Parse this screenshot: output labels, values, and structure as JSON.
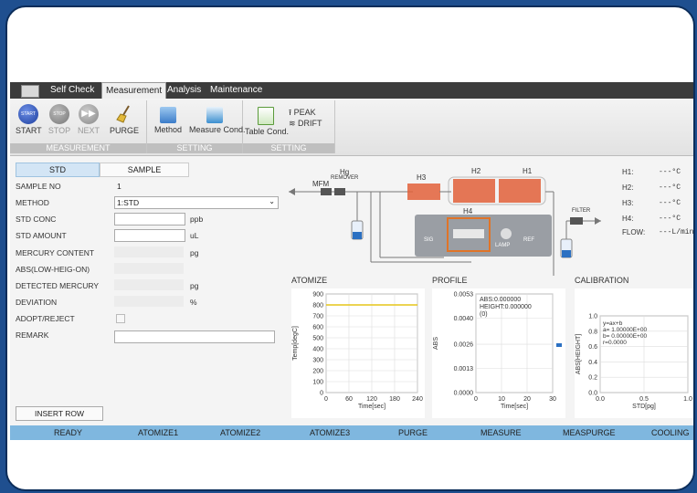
{
  "menubar": {
    "tabs": [
      "Self Check",
      "Measurement",
      "Analysis",
      "Maintenance"
    ]
  },
  "ribbon": {
    "groups": {
      "measurement": "MEASUREMENT",
      "setting1": "SETTING",
      "setting2": "SETTING"
    },
    "start": "START",
    "stop": "STOP",
    "next": "NEXT",
    "purge": "PURGE",
    "method": "Method",
    "measure_cond": "Measure Cond.",
    "table_cond": "Table Cond.",
    "peak": "PEAK",
    "drift": "DRIFT",
    "start_icon_text": "START",
    "stop_icon_text": "STOP"
  },
  "left_tabs": {
    "std": "STD",
    "sample": "SAMPLE"
  },
  "form": {
    "sample_no_label": "SAMPLE NO",
    "sample_no": "1",
    "method_label": "METHOD",
    "method_value": "1:STD",
    "std_conc_label": "STD CONC",
    "std_conc_unit": "ppb",
    "std_amount_label": "STD AMOUNT",
    "std_amount_unit": "uL",
    "mercury_content_label": "MERCURY CONTENT",
    "mercury_content_unit": "pg",
    "abs_label": "ABS(LOW-HEIG-ON)",
    "detected_label": "DETECTED MERCURY",
    "detected_unit": "pg",
    "deviation_label": "DEVIATION",
    "deviation_unit": "%",
    "adopt_label": "ADOPT/REJECT",
    "remark_label": "REMARK",
    "insert_row": "INSERT ROW"
  },
  "diagram": {
    "mfm": "MFM",
    "hg": "Hg",
    "remover": "REMOVER",
    "h1": "H1",
    "h2": "H2",
    "h3": "H3",
    "h4": "H4",
    "sig": "SIG",
    "lamp": "LAMP",
    "ref": "REF",
    "filter": "FILTER",
    "readouts": [
      {
        "label": "H1:",
        "value": "---°C"
      },
      {
        "label": "H2:",
        "value": "---°C"
      },
      {
        "label": "H3:",
        "value": "---°C"
      },
      {
        "label": "H4:",
        "value": "---°C"
      },
      {
        "label": "FLOW:",
        "value": "---L/min"
      }
    ]
  },
  "charts": {
    "atomize": {
      "title": "ATOMIZE",
      "ylabel": "Temp[degC]",
      "xlabel": "Time[sec]"
    },
    "profile": {
      "title": "PROFILE",
      "ylabel": "ABS",
      "xlabel": "Time[sec]",
      "legend": [
        "ABS:0.000000",
        "HEIGHT:0.000000",
        "(0)"
      ]
    },
    "calibration": {
      "title": "CALIBRATION",
      "ylabel": "ABS[HEIGHT]",
      "xlabel": "STD[pg]",
      "legend": [
        "y=ax+b",
        "a= 1.00000E+00",
        "b= 0.00000E+00",
        "r=0.0000"
      ]
    }
  },
  "chart_data": [
    {
      "type": "line",
      "title": "ATOMIZE",
      "xlabel": "Time[sec]",
      "ylabel": "Temp[degC]",
      "xlim": [
        0,
        240
      ],
      "ylim": [
        0,
        900
      ],
      "xticks": [
        "0",
        "60",
        "120",
        "180",
        "240"
      ],
      "yticks": [
        "0",
        "100",
        "200",
        "300",
        "400",
        "500",
        "600",
        "700",
        "800",
        "900"
      ],
      "series": [
        {
          "x": [
            0,
            240
          ],
          "y": [
            800,
            800
          ]
        }
      ],
      "grid": true
    },
    {
      "type": "line",
      "title": "PROFILE",
      "xlabel": "Time[sec]",
      "ylabel": "ABS",
      "xlim": [
        0,
        30
      ],
      "ylim": [
        0,
        0.0053
      ],
      "xticks": [
        "0",
        "10",
        "20",
        "30"
      ],
      "yticks": [
        "0.0000",
        "0.0013",
        "0.0026",
        "0.0040",
        "0.0053"
      ],
      "series": [],
      "grid": true
    },
    {
      "type": "scatter",
      "title": "CALIBRATION",
      "xlabel": "STD[pg]",
      "ylabel": "ABS[HEIGHT]",
      "xlim": [
        0,
        1.0
      ],
      "ylim": [
        0,
        1.0
      ],
      "xticks": [
        "0.0",
        "0.5",
        "1.0"
      ],
      "yticks": [
        "0.0",
        "0.2",
        "0.4",
        "0.6",
        "0.8",
        "1.0"
      ],
      "series": [],
      "grid": true
    }
  ],
  "status": [
    "READY",
    "ATOMIZE1",
    "ATOMIZE2",
    "ATOMIZE3",
    "PURGE",
    "MEASURE",
    "MEASPURGE",
    "COOLING"
  ],
  "colors": {
    "status_bg": "#7fb7df",
    "atomize_line": "#e6c619",
    "heater": "#e2603a",
    "lamp_box": "#e07428"
  }
}
